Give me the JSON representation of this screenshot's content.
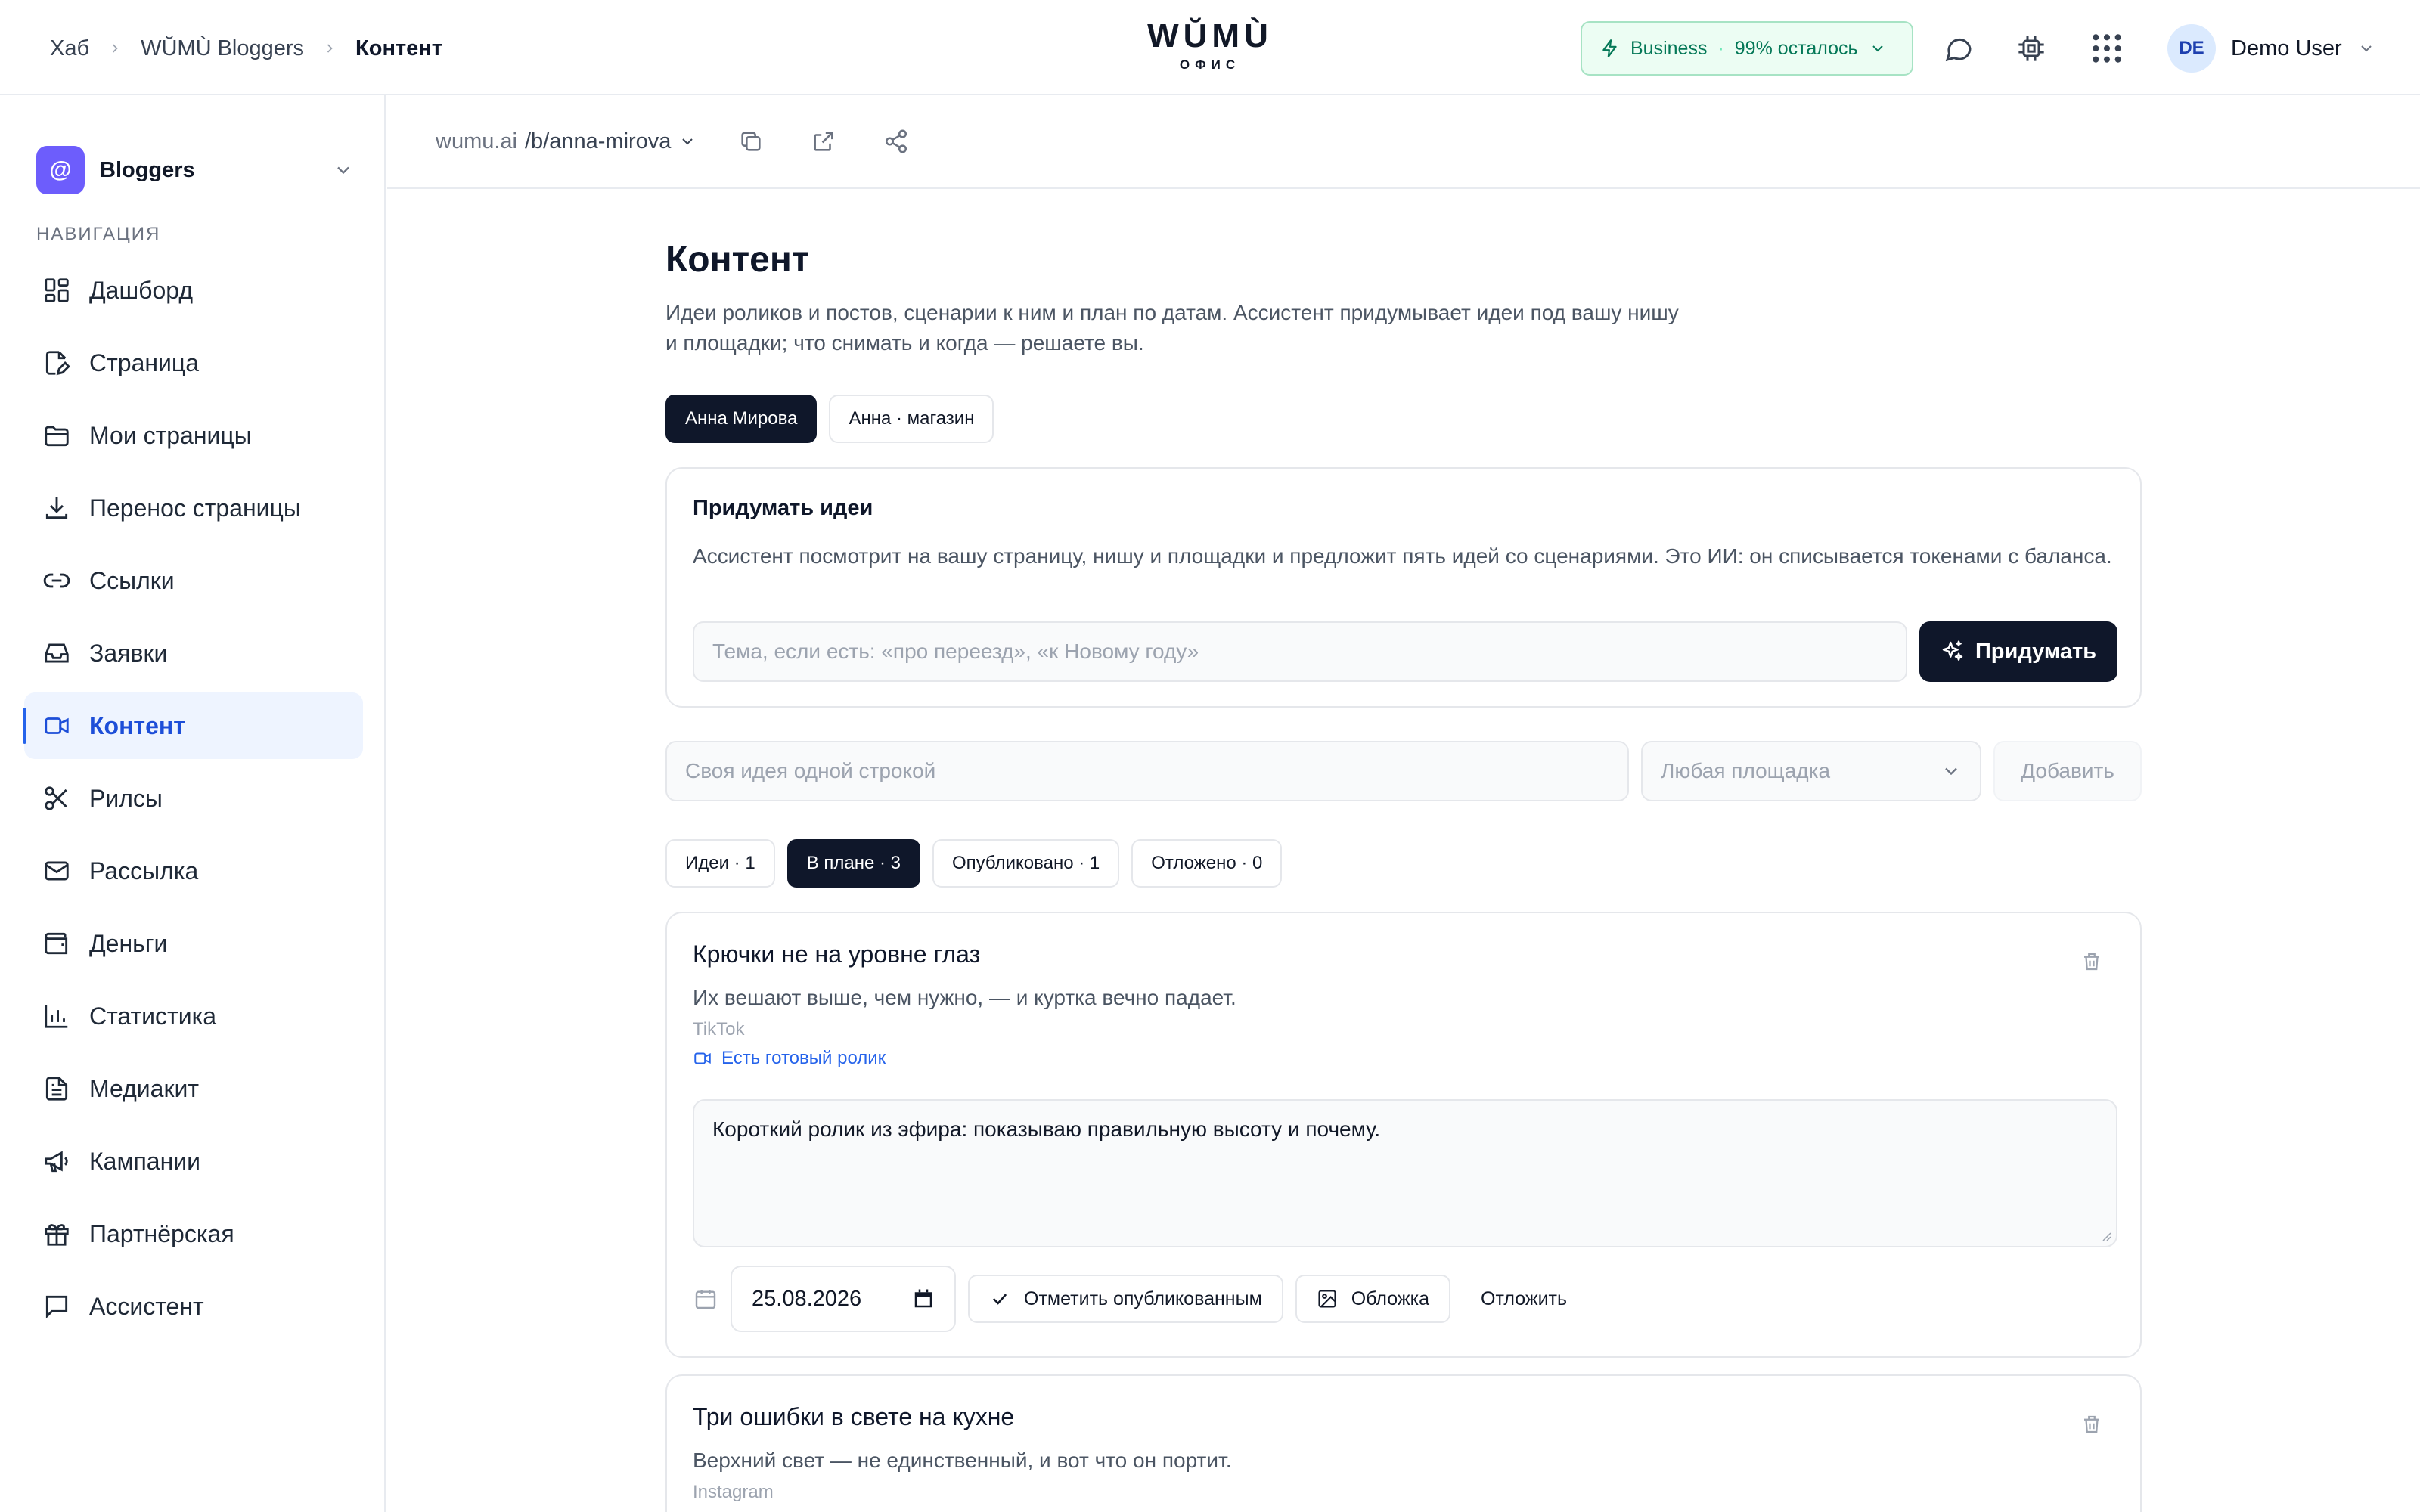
{
  "header": {
    "breadcrumb": [
      "Хаб",
      "WŬMÙ Bloggers",
      "Контент"
    ],
    "logo": {
      "brand": "WŬMÙ",
      "subtitle": "ОФИС"
    },
    "plan": {
      "name": "Business",
      "separator": "·",
      "remaining": "99% осталось"
    },
    "user": {
      "initials": "DE",
      "name": "Demo User"
    }
  },
  "sidebar": {
    "workspace": {
      "icon": "@",
      "name": "Bloggers"
    },
    "heading": "НАВИГАЦИЯ",
    "items": [
      {
        "label": "Дашборд",
        "icon": "dashboard-icon"
      },
      {
        "label": "Страница",
        "icon": "page-edit-icon"
      },
      {
        "label": "Мои страницы",
        "icon": "folder-icon"
      },
      {
        "label": "Перенос страницы",
        "icon": "download-icon"
      },
      {
        "label": "Ссылки",
        "icon": "link-icon"
      },
      {
        "label": "Заявки",
        "icon": "inbox-icon"
      },
      {
        "label": "Контент",
        "icon": "video-icon",
        "active": true
      },
      {
        "label": "Рилсы",
        "icon": "scissors-icon"
      },
      {
        "label": "Рассылка",
        "icon": "mail-icon"
      },
      {
        "label": "Деньги",
        "icon": "wallet-icon"
      },
      {
        "label": "Статистика",
        "icon": "bar-chart-icon"
      },
      {
        "label": "Медиакит",
        "icon": "document-icon"
      },
      {
        "label": "Кампании",
        "icon": "megaphone-icon"
      },
      {
        "label": "Партнёрская",
        "icon": "gift-icon"
      },
      {
        "label": "Ассистент",
        "icon": "chat-icon"
      }
    ]
  },
  "subheader": {
    "domain": "wumu.ai",
    "path": "/b/anna-mirova"
  },
  "main": {
    "title": "Контент",
    "description": "Идеи роликов и постов, сценарии к ним и план по датам. Ассистент придумывает идеи под вашу нишу и площадки; что снимать и когда — решаете вы.",
    "profiles": [
      {
        "label": "Анна Мирова",
        "active": true
      },
      {
        "label": "Анна · магазин",
        "active": false
      }
    ],
    "generator": {
      "title": "Придумать идеи",
      "description": "Ассистент посмотрит на вашу страницу, нишу и площадки и предложит пять идей со сценариями. Это ИИ: он списывается токенами с баланса.",
      "placeholder": "Тема, если есть: «про переезд», «к Новому году»",
      "button": "Придумать"
    },
    "idea_form": {
      "placeholder": "Своя идея одной строкой",
      "platform": "Любая площадка",
      "add": "Добавить"
    },
    "status_tabs": [
      {
        "label": "Идеи · 1",
        "active": false
      },
      {
        "label": "В плане · 3",
        "active": true
      },
      {
        "label": "Опубликовано · 1",
        "active": false
      },
      {
        "label": "Отложено · 0",
        "active": false
      }
    ],
    "cards": [
      {
        "title": "Крючки не на уровне глаз",
        "description": "Их вешают выше, чем нужно, — и куртка вечно падает.",
        "platform": "TikTok",
        "ready": "Есть готовый ролик",
        "script": "Короткий ролик из эфира: показываю правильную высоту и почему.",
        "date": "25.08.2026",
        "mark_published": "Отметить опубликованным",
        "cover": "Обложка",
        "postpone": "Отложить"
      },
      {
        "title": "Три ошибки в свете на кухне",
        "description": "Верхний свет — не единственный, и вот что он портит.",
        "platform": "Instagram"
      }
    ]
  }
}
